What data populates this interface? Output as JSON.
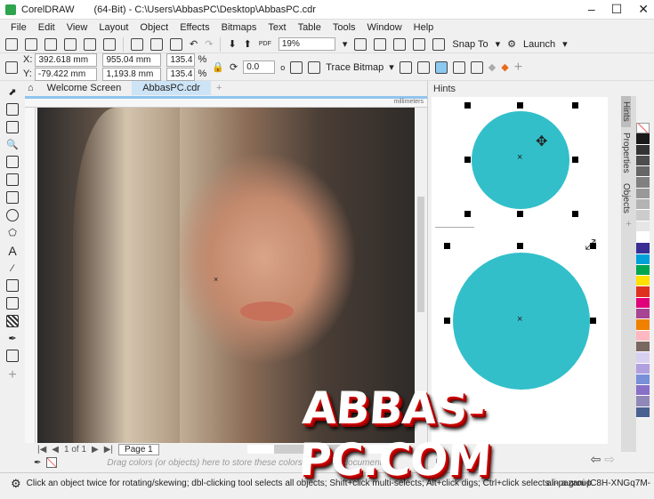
{
  "title": {
    "app": "CorelDRAW",
    "path": "(64-Bit) - C:\\Users\\AbbasPC\\Desktop\\AbbasPC.cdr"
  },
  "menu": [
    "File",
    "Edit",
    "View",
    "Layout",
    "Object",
    "Effects",
    "Bitmaps",
    "Text",
    "Table",
    "Tools",
    "Window",
    "Help"
  ],
  "toolbar": {
    "zoom": "19%",
    "snap_to": "Snap To",
    "launch": "Launch",
    "pdf": "PDF"
  },
  "propbar": {
    "x": "392.618 mm",
    "y": "-79.422 mm",
    "width": "955.04 mm",
    "height": "1,193.8 mm",
    "scale_x": "135.4",
    "scale_y": "135.4",
    "pct": "%",
    "x_label": "X:",
    "y_label": "Y:",
    "rotation": "0.0",
    "deg": "o",
    "trace_bitmap": "Trace Bitmap"
  },
  "tabs": [
    "Welcome Screen",
    "AbbasPC.cdr"
  ],
  "ruler_unit": "millimeters",
  "pagebar": {
    "position": "1 of 1",
    "page": "Page 1"
  },
  "docpalette_hint": "Drag colors (or objects) here to store these colors with your document",
  "hints": {
    "title": "Hints"
  },
  "dock_tabs": [
    "Hints",
    "Properties",
    "Objects"
  ],
  "palette": [
    "#1a1a1a",
    "#333333",
    "#4d4d4d",
    "#666666",
    "#808080",
    "#999999",
    "#b3b3b3",
    "#cccccc",
    "#e6e6e6",
    "#ffffff",
    "#3a2e94",
    "#00a0d8",
    "#00a650",
    "#ffe000",
    "#e03020",
    "#e0007a",
    "#a84494",
    "#f08000",
    "#ffb8c0",
    "#786860",
    "#d8d0f0",
    "#b0a0e0",
    "#7890d8",
    "#8870c8",
    "#9088b8",
    "#4a6090"
  ],
  "status": {
    "message": "Click an object twice for rotating/skewing; dbl-clicking tool selects all objects; Shift+click multi-selects; Alt+click digs; Ctrl+click selects in a group",
    "object": "ali-pazani-IC8H-XNGq7M-"
  },
  "watermark": "ABBAS-PC.COM"
}
